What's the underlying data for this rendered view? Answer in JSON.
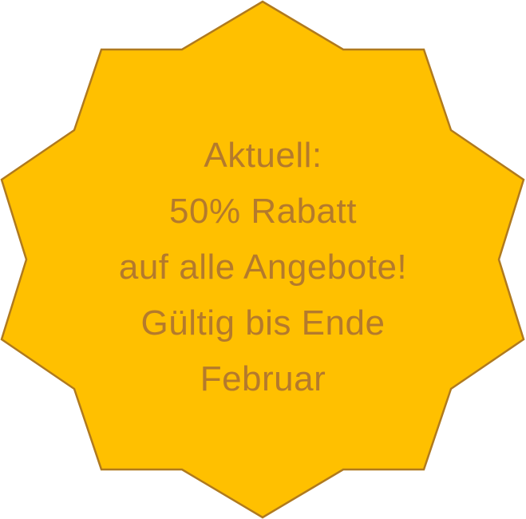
{
  "badge": {
    "lines": [
      "Aktuell:",
      "50% Rabatt",
      "auf alle Angebote!",
      "Gültig bis Ende",
      "Februar"
    ]
  },
  "colors": {
    "fill": "#FFC000",
    "outline": "#B07A1E",
    "text": "#B47A2C",
    "background": "#FFFFFF"
  },
  "icon": "ten-point-star-badge"
}
